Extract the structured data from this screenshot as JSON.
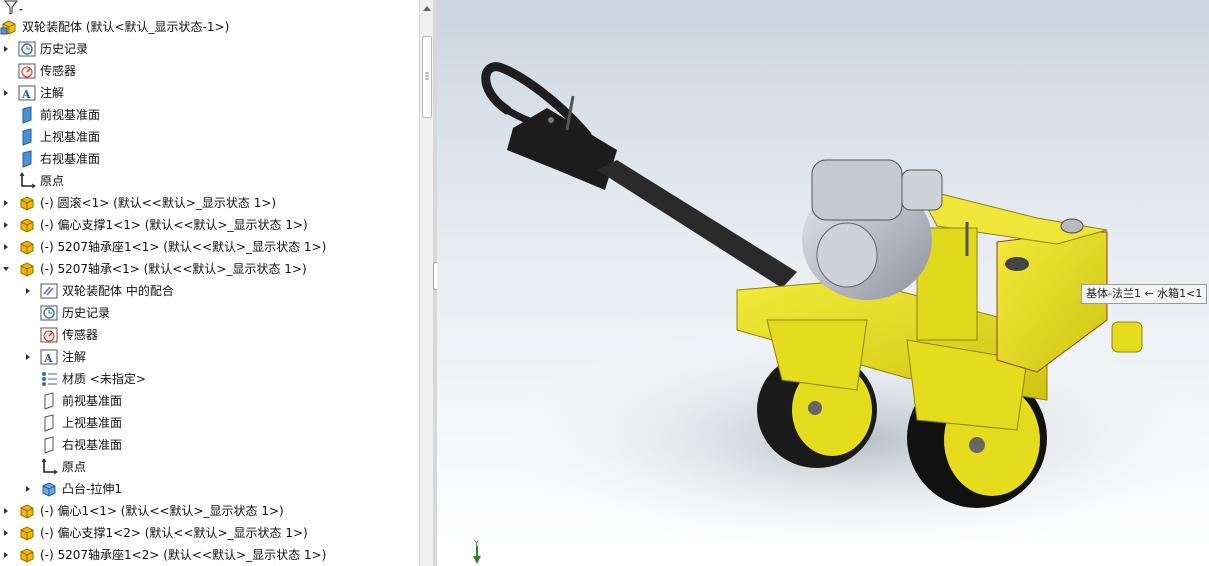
{
  "tree": {
    "rows": [
      {
        "label": "双轮装配体  (默认<默认_显示状态-1>)"
      },
      {
        "label": "历史记录"
      },
      {
        "label": "传感器"
      },
      {
        "label": "注解"
      },
      {
        "label": "前视基准面"
      },
      {
        "label": "上视基准面"
      },
      {
        "label": "右视基准面"
      },
      {
        "label": "原点"
      },
      {
        "label": "(-) 圆滚<1> (默认<<默认>_显示状态 1>)"
      },
      {
        "label": "(-) 偏心支撑1<1> (默认<<默认>_显示状态 1>)"
      },
      {
        "label": "(-) 5207轴承座1<1> (默认<<默认>_显示状态 1>)"
      },
      {
        "label": "(-) 5207轴承<1> (默认<<默认>_显示状态 1>)"
      },
      {
        "label": "双轮装配体 中的配合"
      },
      {
        "label": "历史记录"
      },
      {
        "label": "传感器"
      },
      {
        "label": "注解"
      },
      {
        "label": "材质 <未指定>"
      },
      {
        "label": "前视基准面"
      },
      {
        "label": "上视基准面"
      },
      {
        "label": "右视基准面"
      },
      {
        "label": "原点"
      },
      {
        "label": "凸台-拉伸1"
      },
      {
        "label": "(-) 偏心1<1> (默认<<默认>_显示状态 1>)"
      },
      {
        "label": "(-) 偏心支撑1<2> (默认<<默认>_显示状态 1>)"
      },
      {
        "label": "(-) 5207轴承座1<2> (默认<<默认>_显示状态 1>)"
      }
    ]
  },
  "viewport": {
    "tooltip": "基体-法兰1 ← 水箱1<1",
    "triad_label": "Y"
  },
  "colors": {
    "accent_yellow": "#e6dc1e",
    "frame_dark": "#2a2a2a",
    "engine_gray": "#b9bcc4"
  }
}
